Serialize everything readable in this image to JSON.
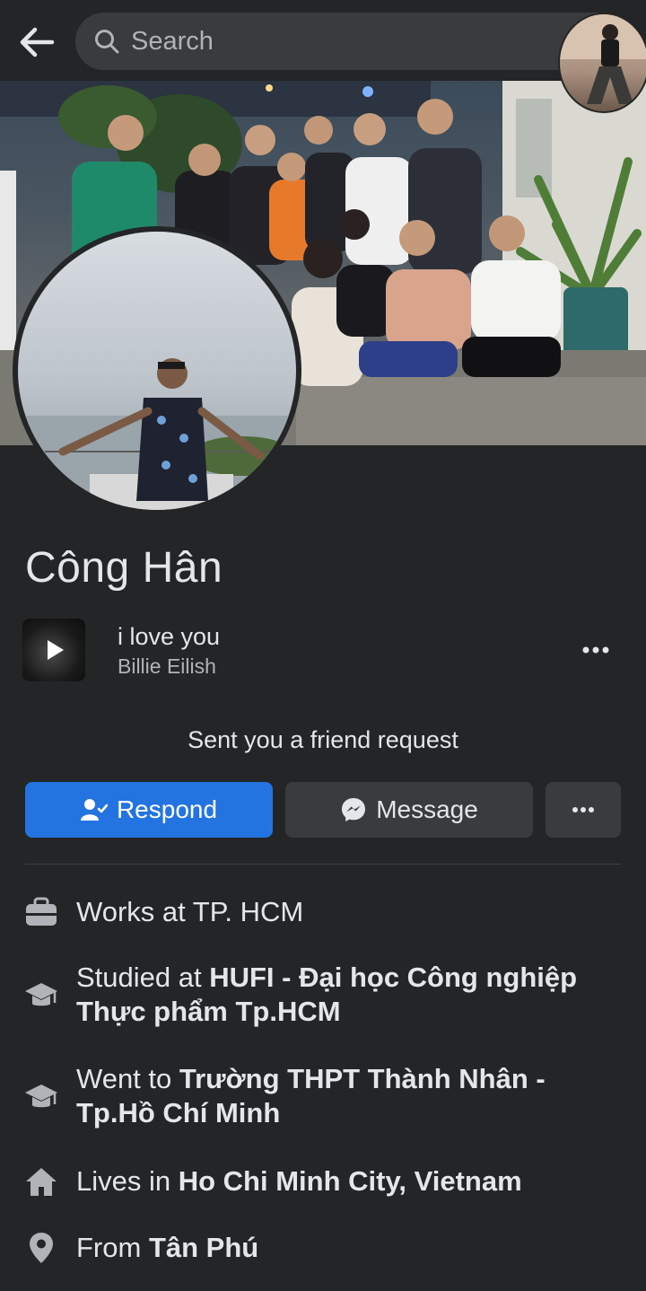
{
  "search": {
    "placeholder": "Search"
  },
  "icons": {
    "back": "arrow-left-icon",
    "search": "search-icon",
    "more": "more-horizontal-icon",
    "respond": "add-friend-icon",
    "message": "messenger-icon",
    "work": "briefcase-icon",
    "education": "graduation-cap-icon",
    "home": "house-icon",
    "location": "location-pin-icon",
    "play": "play-icon"
  },
  "colors": {
    "background": "#242526",
    "accent": "#2374e1",
    "secondary_button": "#3a3b3c",
    "text_primary": "#e4e6eb",
    "text_secondary": "#b0b3b8"
  },
  "profile": {
    "name": "Công Hân"
  },
  "music": {
    "title": "i love you",
    "artist": "Billie Eilish"
  },
  "friend_request": {
    "text": "Sent you a friend request",
    "respond_label": "Respond",
    "message_label": "Message"
  },
  "details": {
    "work": {
      "prefix": "Works at TP. HCM"
    },
    "study": {
      "prefix": "Studied at ",
      "place": "HUFI - Đại học Công nghiệp Thực phẩm Tp.HCM"
    },
    "school": {
      "prefix": "Went to ",
      "place": "Trường THPT Thành Nhân - Tp.Hồ Chí Minh"
    },
    "lives": {
      "prefix": "Lives in ",
      "place": "Ho Chi Minh City, Vietnam"
    },
    "from": {
      "prefix": "From ",
      "place": "Tân Phú"
    }
  }
}
